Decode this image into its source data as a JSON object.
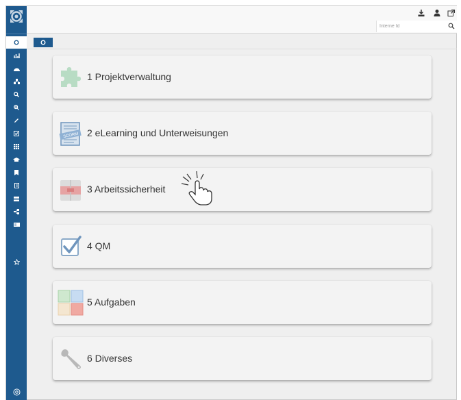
{
  "search": {
    "placeholder": "Interne Id",
    "value": ""
  },
  "sidebar": {
    "items": [
      {
        "icon": "home-icon"
      },
      {
        "icon": "chart-icon"
      },
      {
        "icon": "dashboard-icon"
      },
      {
        "icon": "org-chart-icon"
      },
      {
        "icon": "search-icon"
      },
      {
        "icon": "zoom-icon"
      },
      {
        "icon": "pencil-icon"
      },
      {
        "icon": "checkbox-icon"
      },
      {
        "icon": "grid-icon"
      },
      {
        "icon": "graduation-cap-icon"
      },
      {
        "icon": "bookmark-icon"
      },
      {
        "icon": "document-icon"
      },
      {
        "icon": "list-icon"
      },
      {
        "icon": "sitemap-icon"
      },
      {
        "icon": "id-card-icon"
      },
      {
        "icon": "star-icon"
      }
    ],
    "bottom_icon": "settings-icon"
  },
  "topbar": {
    "icons": [
      "download-icon",
      "user-icon",
      "external-link-icon"
    ]
  },
  "modules": [
    {
      "label": "1 Projektverwaltung",
      "icon": "puzzle-icon"
    },
    {
      "label": "2 eLearning und Unterweisungen",
      "icon": "scorm-book-icon"
    },
    {
      "label": "3 Arbeitssicherheit",
      "icon": "toolbox-icon"
    },
    {
      "label": "4 QM",
      "icon": "checkmark-icon"
    },
    {
      "label": "5 Aufgaben",
      "icon": "tiles-icon"
    },
    {
      "label": "6 Diverses",
      "icon": "wrench-icon"
    }
  ],
  "colors": {
    "sidebar": "#1e5a8e",
    "background": "#efefef",
    "card": "#f3f3f3",
    "text": "#333333"
  }
}
